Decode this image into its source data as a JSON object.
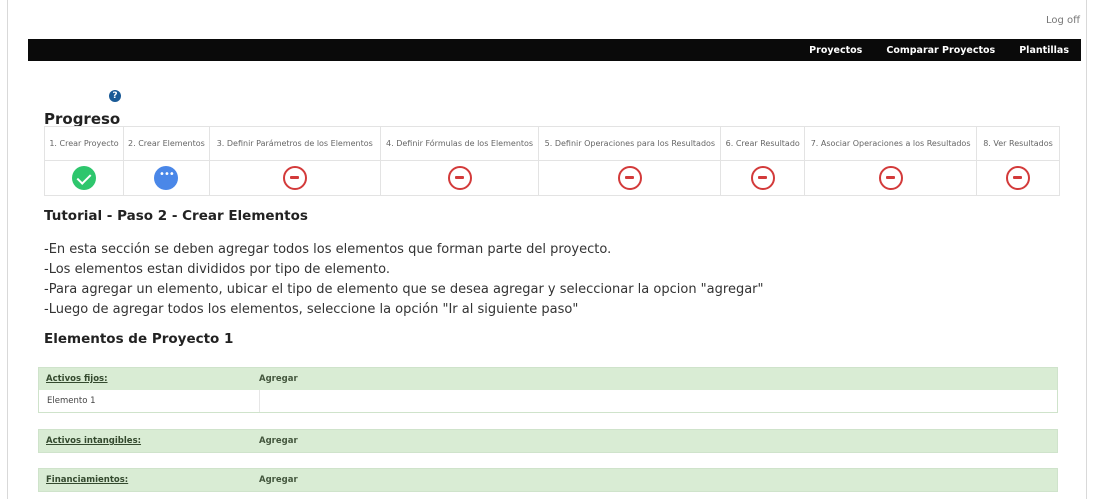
{
  "header": {
    "logoff": "Log off"
  },
  "nav": {
    "items": [
      "Proyectos",
      "Comparar Proyectos",
      "Plantillas"
    ]
  },
  "progress": {
    "title": "Progreso",
    "help_icon": "?",
    "steps": [
      {
        "label": "1. Crear Proyecto",
        "status": "done"
      },
      {
        "label": "2. Crear Elementos",
        "status": "current"
      },
      {
        "label": "3. Definir Parámetros de los Elementos",
        "status": "blocked"
      },
      {
        "label": "4. Definir Fórmulas de los Elementos",
        "status": "blocked"
      },
      {
        "label": "5. Definir Operaciones para los Resultados",
        "status": "blocked"
      },
      {
        "label": "6. Crear Resultado",
        "status": "blocked"
      },
      {
        "label": "7. Asociar Operaciones a los Resultados",
        "status": "blocked"
      },
      {
        "label": "8. Ver Resultados",
        "status": "blocked"
      }
    ]
  },
  "tutorial": {
    "title": "Tutorial - Paso 2 - Crear Elementos",
    "lines": [
      "-En esta sección se deben agregar todos los elementos que forman parte del proyecto.",
      "-Los elementos estan divididos por tipo de elemento.",
      "-Para agregar un elemento, ubicar el tipo de elemento que se desea agregar y seleccionar la opcion \"agregar\"",
      "-Luego de agregar todos los elementos, seleccione la opción \"Ir al siguiente paso\""
    ]
  },
  "elements": {
    "title": "Elementos de Proyecto 1",
    "groups": [
      {
        "name": "Activos fijos:",
        "add": "Agregar",
        "items": [
          "Elemento 1"
        ]
      },
      {
        "name": "Activos intangibles:",
        "add": "Agregar",
        "items": []
      },
      {
        "name": "Financiamientos:",
        "add": "Agregar",
        "items": []
      }
    ]
  }
}
